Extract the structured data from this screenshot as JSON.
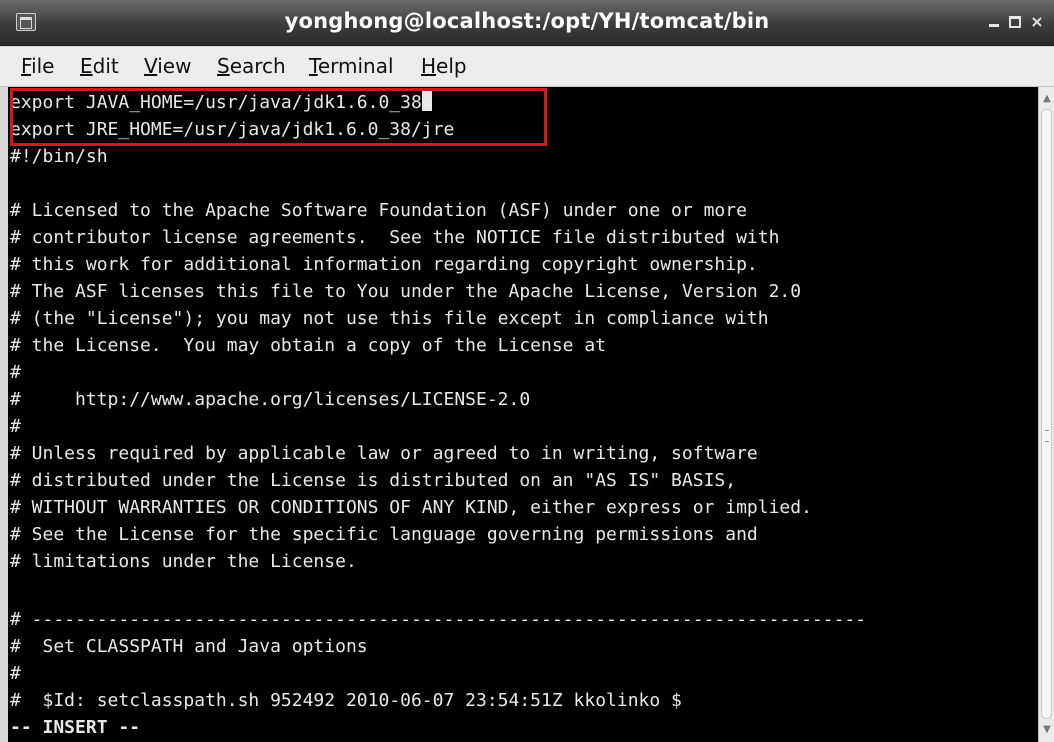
{
  "window": {
    "title": "yonghong@localhost:/opt/YH/tomcat/bin",
    "icon": "terminal-icon",
    "minimize_icon": "minimize-icon",
    "maximize_icon": "maximize-icon",
    "close_glyph": "×"
  },
  "menu": [
    {
      "mn": "F",
      "rest": "ile"
    },
    {
      "mn": "E",
      "rest": "dit"
    },
    {
      "mn": "V",
      "rest": "iew"
    },
    {
      "mn": "S",
      "rest": "earch"
    },
    {
      "mn": "T",
      "rest": "erminal"
    },
    {
      "mn": "H",
      "rest": "elp"
    }
  ],
  "terminal": {
    "lines": [
      "export JAVA_HOME=/usr/java/jdk1.6.0_38",
      "export JRE_HOME=/usr/java/jdk1.6.0_38/jre",
      "#!/bin/sh",
      "",
      "# Licensed to the Apache Software Foundation (ASF) under one or more",
      "# contributor license agreements.  See the NOTICE file distributed with",
      "# this work for additional information regarding copyright ownership.",
      "# The ASF licenses this file to You under the Apache License, Version 2.0",
      "# (the \"License\"); you may not use this file except in compliance with",
      "# the License.  You may obtain a copy of the License at",
      "#",
      "#     http://www.apache.org/licenses/LICENSE-2.0",
      "#",
      "# Unless required by applicable law or agreed to in writing, software",
      "# distributed under the License is distributed on an \"AS IS\" BASIS,",
      "# WITHOUT WARRANTIES OR CONDITIONS OF ANY KIND, either express or implied.",
      "# See the License for the specific language governing permissions and",
      "# limitations under the License.",
      "",
      "",
      "# -----------------------------------------------------------------------------",
      "#  Set CLASSPATH and Java options",
      "#",
      "#  $Id: setclasspath.sh 952492 2010-06-07 23:54:51Z kkolinko $"
    ],
    "mode_line": "-- INSERT --",
    "highlight_color": "#d21a1a"
  },
  "colors": {
    "terminal_bg": "#000000",
    "terminal_fg": "#e8e8e8"
  }
}
